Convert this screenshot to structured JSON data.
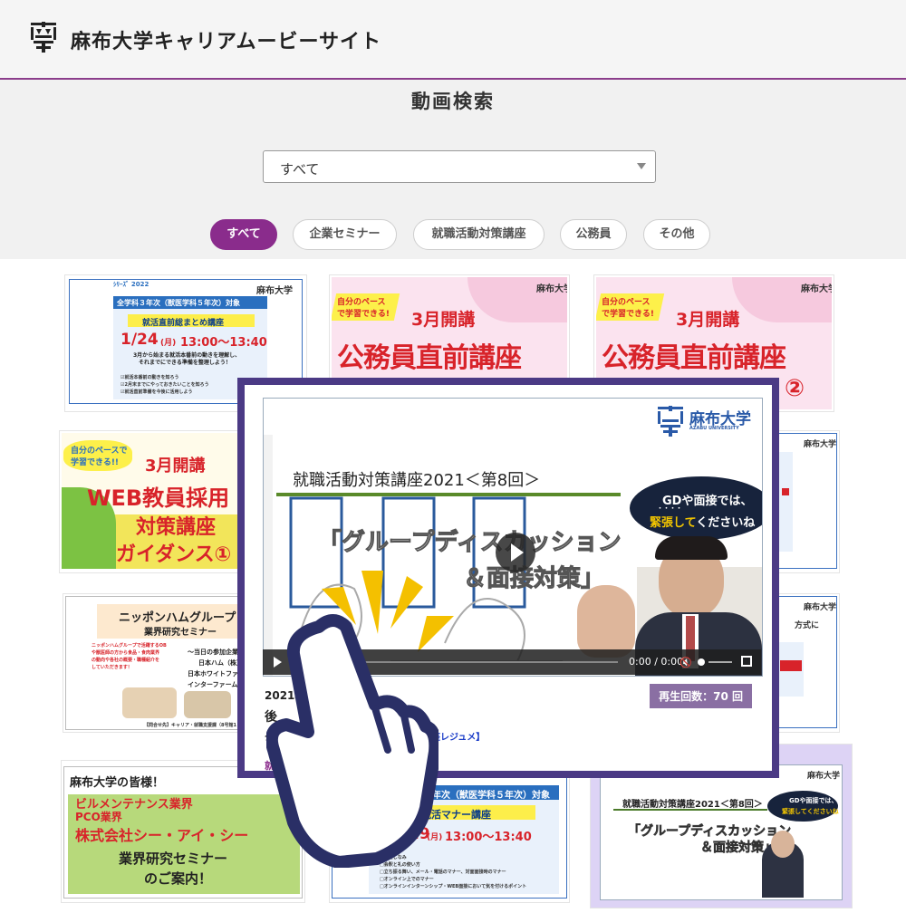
{
  "header": {
    "site_title": "麻布大学キャリアムービーサイト"
  },
  "search": {
    "page_title": "動画検索",
    "select_value": "すべて",
    "chips": [
      "すべて",
      "企業セミナー",
      "就職活動対策講座",
      "公務員",
      "その他"
    ],
    "active_chip": "すべて"
  },
  "cards": {
    "c1": {
      "top_label": "全学科３年次（獣医学科５年次）対象",
      "title": "就活直前総まとめ講座",
      "date": "1/24",
      "weekday": "(月)",
      "time": "13:00〜13:40",
      "desc1": "3月から始まる就活本番前の動きを理解し、",
      "desc2": "それまでにできる準備を整理しよう！",
      "notes": [
        "☑就活本番前の動きを知ろう",
        "☑2月末までにやっておきたいことを知ろう",
        "☑就活直前準備を今後に活用しよう"
      ],
      "logo": "麻布大学"
    },
    "c2": {
      "self_pace": "自分のペースで学習できる!",
      "month": "3月開講",
      "title": "公務員直前講座",
      "logo": "麻布大学"
    },
    "c3": {
      "self_pace": "自分のペースで学習できる!",
      "month": "3月開講",
      "title": "公務員直前講座",
      "num": "②",
      "logo": "麻布大学"
    },
    "c4": {
      "self_pace": "自分のペースで学習できる!!",
      "month": "3月開講",
      "line1": "WEB教員採用",
      "line2": "対策講座",
      "line3": "ガイダンス①"
    },
    "c6": {
      "logo": "麻布大学"
    },
    "c7": {
      "title": "ニッポンハムグループ",
      "subtitle": "業界研究セミナー",
      "left1": "ニッポンハムグループで活躍するOB",
      "left2": "や獣医師の方から食品・食肉業界",
      "left3": "の動向や各社の概要・職種紹介を",
      "left4": "していただきます！",
      "right1": "〜当日の参加企業",
      "right2": "日本ハム（株）",
      "right3": "日本ホワイトファーム",
      "right4": "インターファーム（株",
      "footer": "【問合せ先】キャリア・就職支援課（8号館1"
    },
    "c9": {
      "logo": "麻布大学",
      "text": "方式に"
    },
    "c10": {
      "line0": "麻布大学の皆様！",
      "line1": "ビルメンテナンス業界",
      "line2": "PCO業界",
      "line3": "株式会社シー・アイ・シー",
      "line4": "業界研究セミナー",
      "line5": "のご案内！"
    },
    "c11": {
      "top_label": "科３年次（獣医学科５年次）対象",
      "title": "就活マナー講座",
      "date": "11/29",
      "weekday": "(月)",
      "time": "13:00〜13:40",
      "items": [
        "□身だしなみ",
        "□会釈と礼の使い方",
        "□立ち振る舞い、メール・電話のマナー、対面面接時のマナー",
        "□オンライン上でのマナー",
        "□オンラインインターンシップ・WEB面接において気を付けるポイント"
      ]
    },
    "c12": {
      "heading": "就職活動対策講座2021＜第8回＞",
      "bubble1": "GDや面接では、",
      "bubble2": "緊張してくださいね",
      "main1": "「グループディスカッション",
      "main2": "＆面接対策」",
      "logo": "麻布大学"
    }
  },
  "overlay": {
    "logo": "麻布大学",
    "logo_sub": "AZABU UNIVERSITY",
    "heading": "就職活動対策講座2021＜第8回＞",
    "bubble1": "GDや面接では、",
    "bubble_dots": "・・・・",
    "bubble2_a": "緊張して",
    "bubble2_b": "くださいね",
    "main1": "「グループディスカッション",
    "main2": "＆面接対策」",
    "time": "0:00 / 0:00",
    "views": "再生回数：70 回",
    "date": "2021年1",
    "title_frag": "後",
    "meta_frag": "グ",
    "resume_link": "【講座レジュメ】",
    "category_frag": "就"
  }
}
